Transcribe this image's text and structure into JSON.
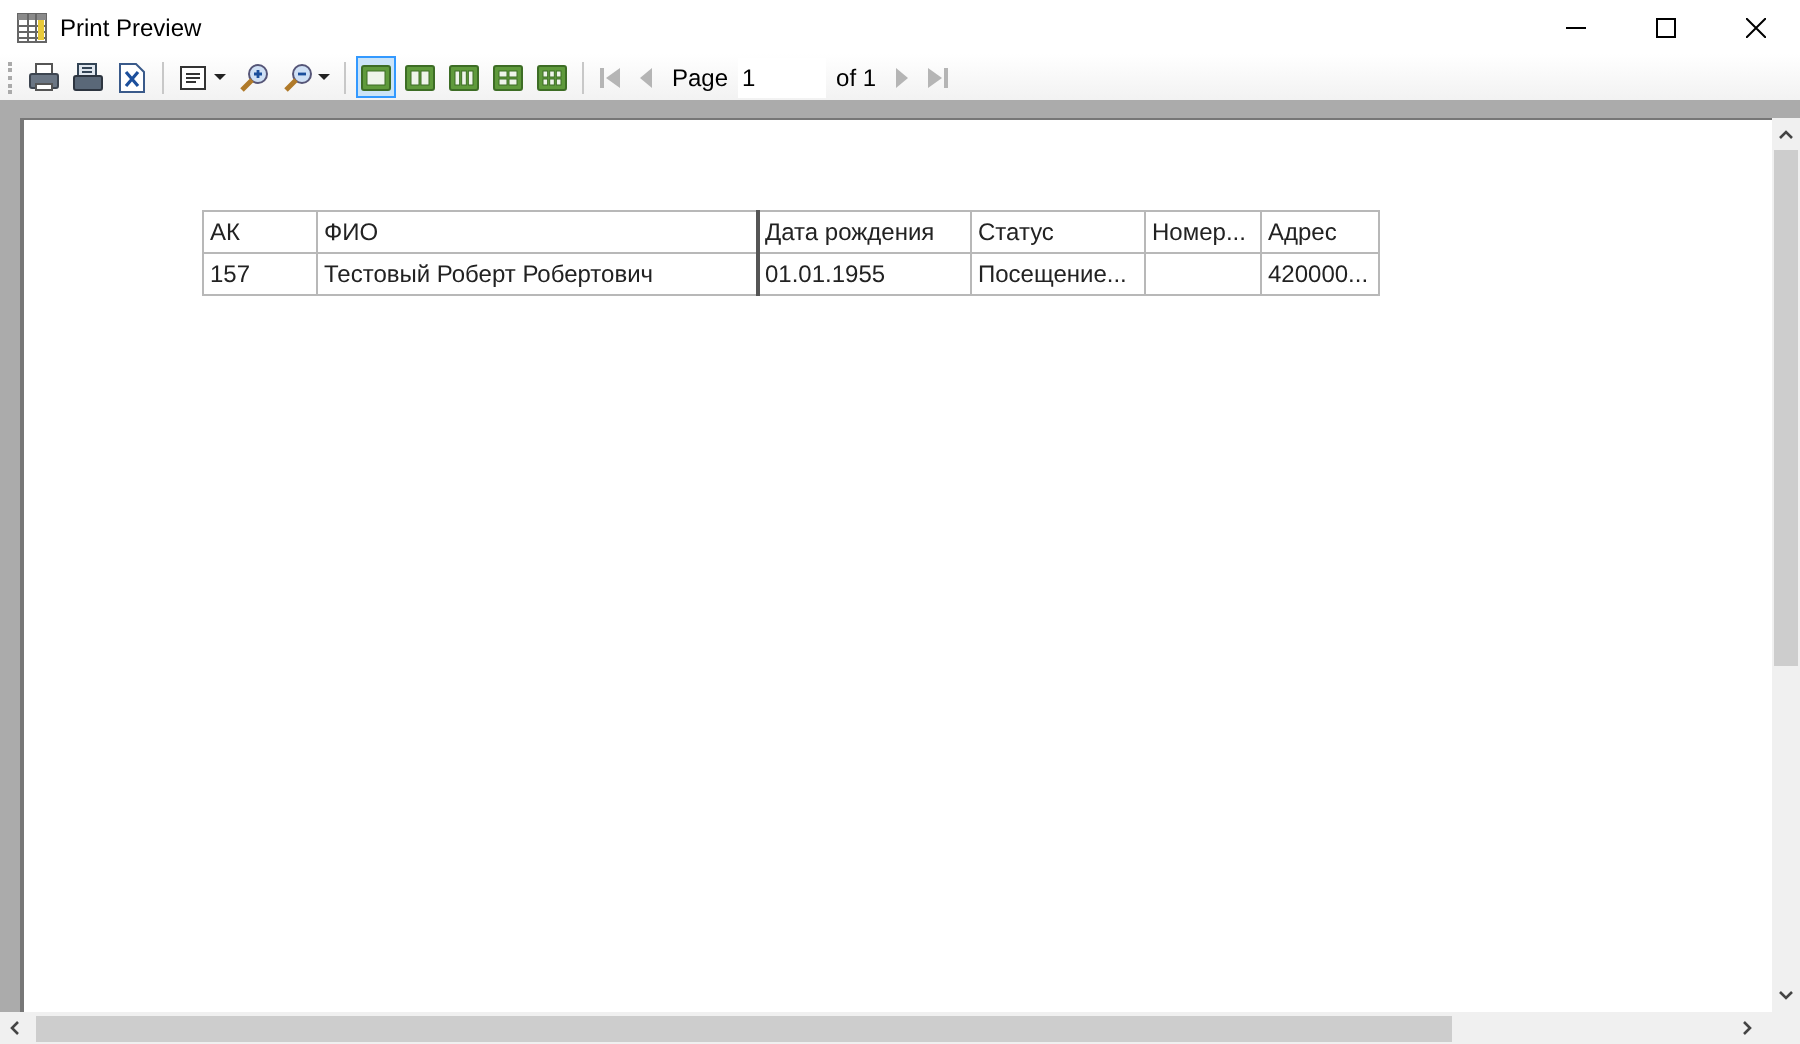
{
  "window": {
    "title": "Print Preview"
  },
  "toolbar": {
    "tools": [
      {
        "kind": "print"
      },
      {
        "kind": "quickprint"
      },
      {
        "kind": "export"
      },
      {
        "kind": "sep"
      },
      {
        "kind": "pagesetup",
        "dropdown": true
      },
      {
        "kind": "zoomin"
      },
      {
        "kind": "zoomout",
        "dropdown": true
      },
      {
        "kind": "sep"
      }
    ],
    "layouts": [
      {
        "kind": "one",
        "selected": true
      },
      {
        "kind": "two",
        "selected": false
      },
      {
        "kind": "three",
        "selected": false
      },
      {
        "kind": "four",
        "selected": false
      },
      {
        "kind": "six",
        "selected": false
      }
    ],
    "nav_before": [
      {
        "kind": "first",
        "disabled": true
      },
      {
        "kind": "prev",
        "disabled": true
      }
    ],
    "page_label": "Page",
    "page_value": "1",
    "page_total": "of 1",
    "nav_after": [
      {
        "kind": "next",
        "disabled": true
      },
      {
        "kind": "last",
        "disabled": true
      }
    ]
  },
  "table": {
    "columns": [
      "АК",
      "ФИО",
      "Дата рождения",
      "Статус",
      "Номер...",
      "Адрес"
    ],
    "rows": [
      [
        "157",
        "Тестовый Роберт Робертович",
        "01.01.1955",
        "Посещение...",
        "",
        "420000..."
      ]
    ]
  }
}
